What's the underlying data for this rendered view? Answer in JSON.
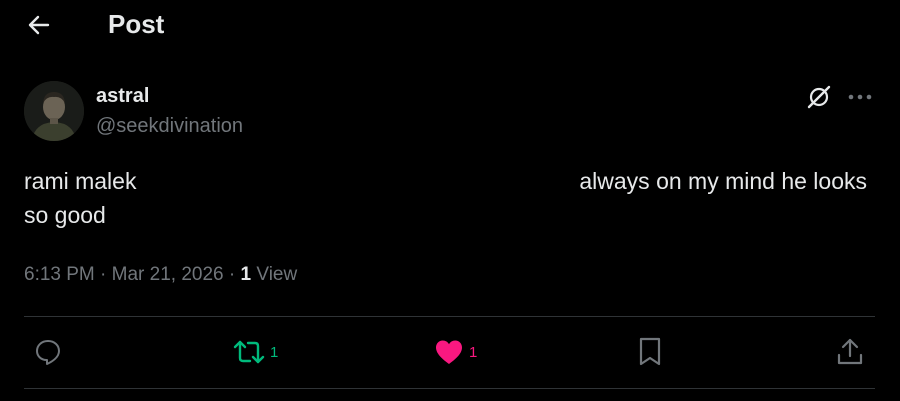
{
  "header": {
    "title": "Post",
    "back_icon": "arrow-left-icon"
  },
  "author": {
    "display_name": "astral",
    "handle": "@seekdivination",
    "avatar": "avatar-photo"
  },
  "post": {
    "text_part1": "rami malek",
    "text_part2": "always on my mind he looks",
    "text_part3": "so good",
    "time": "6:13 PM",
    "separator": "·",
    "date": "Mar 21, 2026",
    "views_count": "1",
    "views_label": "View"
  },
  "actions": {
    "reply": {
      "icon": "reply-icon"
    },
    "repost": {
      "icon": "repost-icon",
      "count": "1",
      "color": "#00ba7c"
    },
    "like": {
      "icon": "heart-icon",
      "count": "1",
      "color": "#f91880"
    },
    "bookmark": {
      "icon": "bookmark-icon"
    },
    "share": {
      "icon": "share-icon"
    }
  },
  "top_right": {
    "grok_icon": "grok-icon",
    "more_icon": "more-horizontal-icon"
  },
  "colors": {
    "background": "#000000",
    "text_primary": "#e7e9ea",
    "text_secondary": "#71767b",
    "divider": "#2f3336"
  }
}
